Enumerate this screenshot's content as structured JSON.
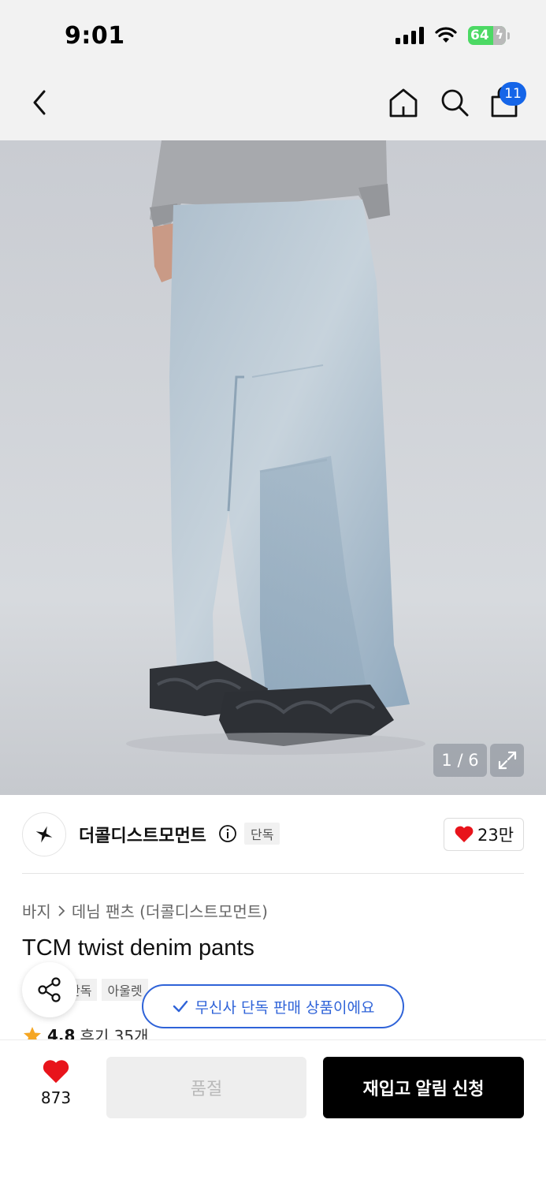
{
  "status_bar": {
    "time": "9:01",
    "battery": "64"
  },
  "header": {
    "cart_count": "11"
  },
  "gallery": {
    "counter": "1 / 6"
  },
  "brand": {
    "name": "더콜디스트모먼트",
    "exclusive_tag": "단독",
    "likes": "23만"
  },
  "breadcrumb": {
    "category": "바지",
    "subcategory": "데님 팬츠 (더콜디스트모먼트)"
  },
  "product": {
    "title": "TCM twist denim pants",
    "tags": [
      "단독",
      "아울렛"
    ],
    "rating": "4.8",
    "reviews": "후기 35개"
  },
  "toast": {
    "message": "무신사 단독 판매 상품이에요"
  },
  "bottom": {
    "wish_count": "873",
    "soldout_label": "품절",
    "restock_label": "재입고 알림 신청"
  },
  "colors": {
    "accent": "#1565e8",
    "toast": "#2f63d8",
    "heart": "#e8141b",
    "star": "#f5a623"
  }
}
